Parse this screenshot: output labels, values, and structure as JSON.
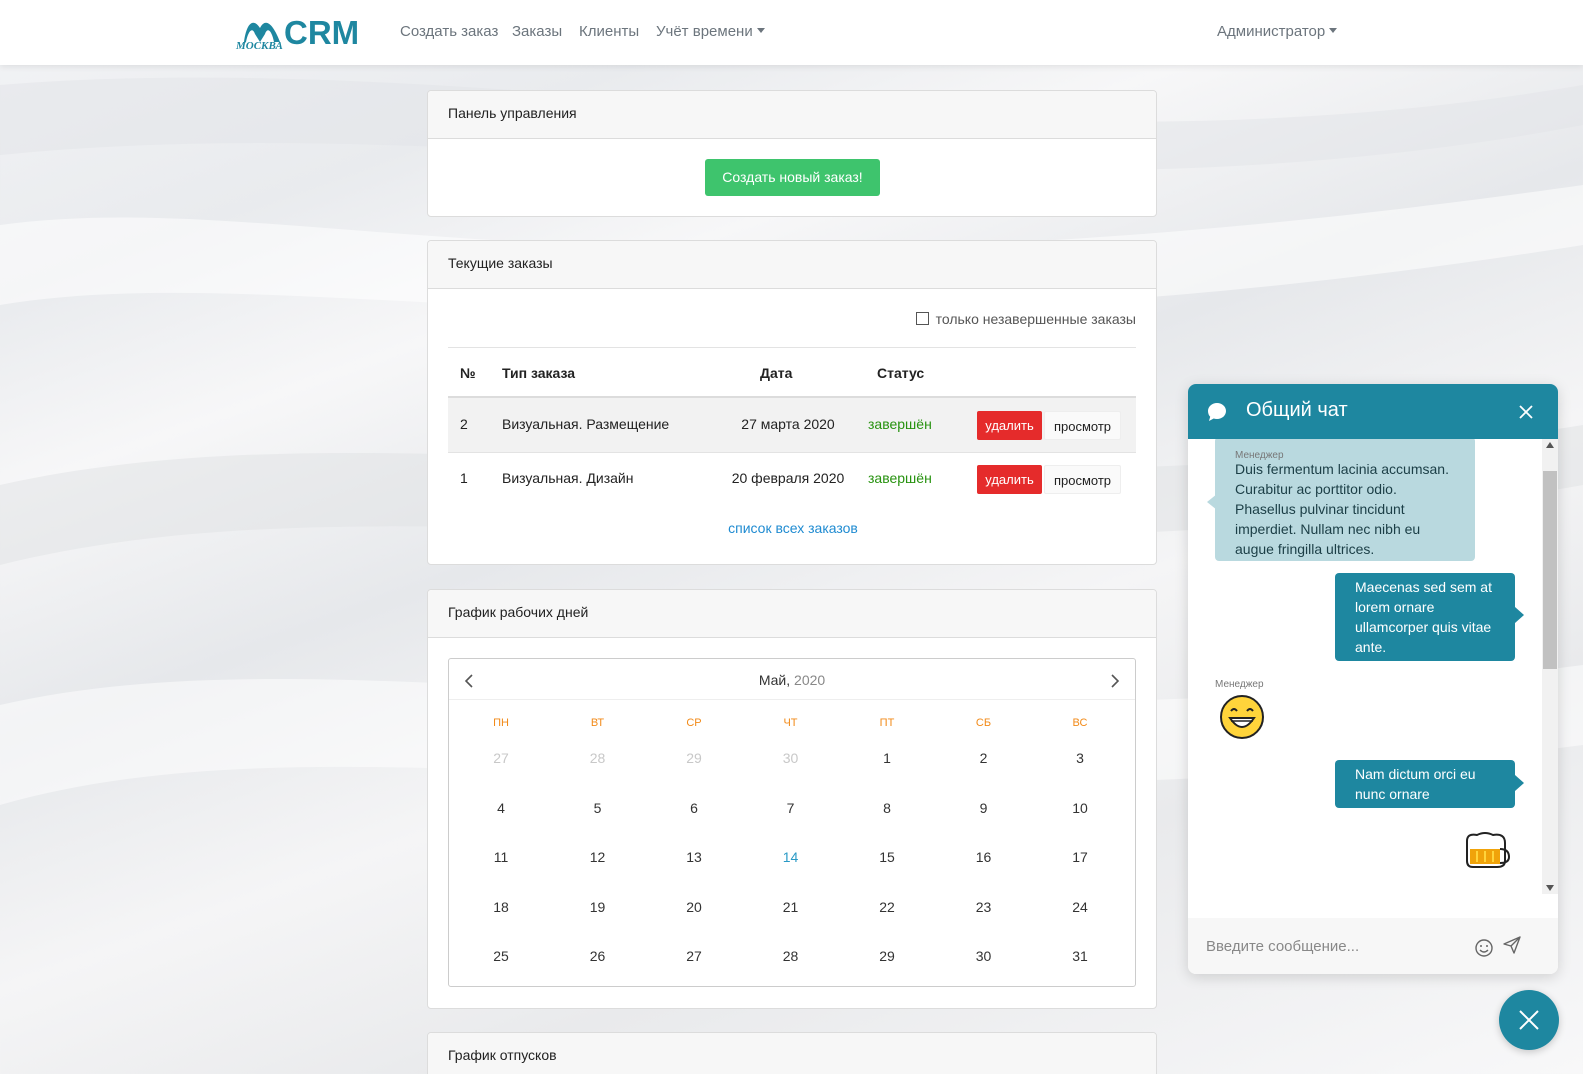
{
  "navbar": {
    "logo_city": "МОСКВА",
    "logo_text": "CRM",
    "links": [
      "Создать заказ",
      "Заказы",
      "Клиенты",
      "Учёт времени"
    ],
    "user": "Администратор"
  },
  "control_panel": {
    "title": "Панель управления",
    "create_button": "Создать новый заказ!"
  },
  "orders": {
    "title": "Текущие заказы",
    "filter_label": "только незавершенные заказы",
    "columns": [
      "№",
      "Тип заказа",
      "Дата",
      "Статус"
    ],
    "rows": [
      {
        "num": "2",
        "type": "Визуальная. Размещение",
        "date": "27 марта 2020",
        "status": "завершён",
        "delete": "удалить",
        "view": "просмотр"
      },
      {
        "num": "1",
        "type": "Визуальная. Дизайн",
        "date": "20 февраля 2020",
        "status": "завершён",
        "delete": "удалить",
        "view": "просмотр"
      }
    ],
    "all_link": "список всех заказов"
  },
  "workdays": {
    "title": "График рабочих дней",
    "month": "Май,",
    "year": "2020",
    "weekdays": [
      "ПН",
      "ВТ",
      "СР",
      "ЧТ",
      "ПТ",
      "СБ",
      "ВС"
    ],
    "weeks": [
      [
        "27",
        "28",
        "29",
        "30",
        "1",
        "2",
        "3"
      ],
      [
        "4",
        "5",
        "6",
        "7",
        "8",
        "9",
        "10"
      ],
      [
        "11",
        "12",
        "13",
        "14",
        "15",
        "16",
        "17"
      ],
      [
        "18",
        "19",
        "20",
        "21",
        "22",
        "23",
        "24"
      ],
      [
        "25",
        "26",
        "27",
        "28",
        "29",
        "30",
        "31"
      ]
    ],
    "muted_leading": 4,
    "today": "14"
  },
  "vacations": {
    "title": "График отпусков"
  },
  "chat": {
    "title": "Общий чат",
    "messages": {
      "m1_sender": "Менеджер",
      "m1_lines": [
        "Duis fermentum lacinia accumsan.",
        "Curabitur ac porttitor odio.",
        "Phasellus pulvinar tincidunt",
        "imperdiet. Nullam nec nibh eu",
        "augue fringilla ultrices."
      ],
      "m2_lines": [
        "Maecenas sed sem at",
        "lorem ornare",
        "ullamcorper quis vitae",
        "ante."
      ],
      "m3_sender": "Менеджер",
      "m4_lines": [
        "Nam dictum orci eu",
        "nunc ornare"
      ]
    },
    "input_placeholder": "Введите сообщение..."
  },
  "colors": {
    "accent": "#1e87a0",
    "success": "#3ec46d",
    "danger": "#e52b2b",
    "status_done": "#27920f",
    "weekday": "#f28a18",
    "link": "#1f8bd1"
  }
}
